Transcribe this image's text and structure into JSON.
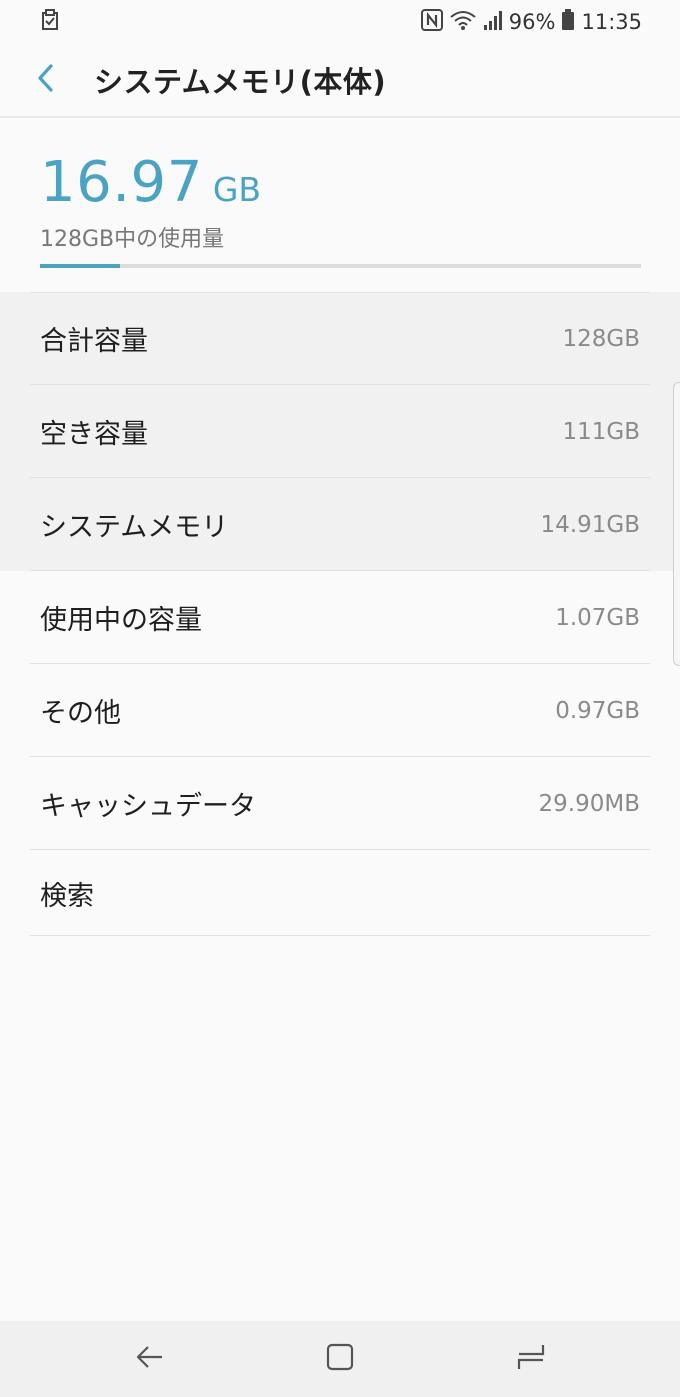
{
  "status_bar": {
    "battery": "96%",
    "time": "11:35",
    "icons": [
      "notification-check-icon",
      "nfc-icon",
      "wifi-icon",
      "signal-icon",
      "battery-icon"
    ]
  },
  "header": {
    "title": "システムメモリ(本体)",
    "back_icon": "back-arrow-icon"
  },
  "summary": {
    "used_value": "16.97",
    "used_unit": "GB",
    "caption": "128GB中の使用量",
    "usage_fraction": 0.1326
  },
  "items": [
    {
      "label": "合計容量",
      "value": "128GB"
    },
    {
      "label": "空き容量",
      "value": "111GB"
    },
    {
      "label": "システムメモリ",
      "value": "14.91GB"
    },
    {
      "label": "使用中の容量",
      "value": "1.07GB"
    },
    {
      "label": "その他",
      "value": "0.97GB"
    },
    {
      "label": "キャッシュデータ",
      "value": "29.90MB"
    },
    {
      "label": "検索",
      "value": ""
    }
  ],
  "colors": {
    "accent": "#4aa3c3",
    "background": "#fafafa",
    "shaded_row": "#f1f1f1"
  },
  "nav_bar": {
    "icons": [
      "nav-back-icon",
      "nav-home-icon",
      "nav-recents-icon"
    ]
  }
}
